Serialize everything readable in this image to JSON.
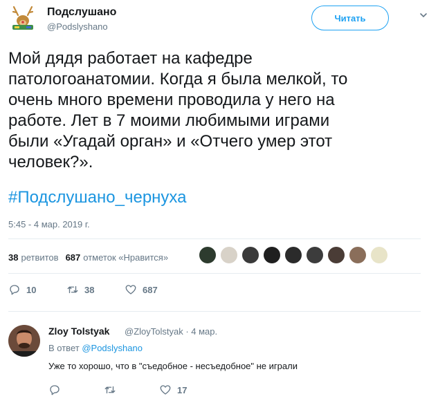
{
  "header": {
    "display_name": "Подслушано",
    "handle": "@Podslyshano",
    "follow_label": "Читать"
  },
  "tweet": {
    "text": "Мой дядя работает на кафедре\nпатологоанатомии. Когда я была мелкой, то\nочень много времени проводила у него на\nработе. Лет в 7 моими любимыми играми\nбыли «Угадай орган» и «Отчего умер этот\nчеловек?».",
    "hashtag": "#Подслушано_чернуха",
    "timestamp": "5:45 - 4 мар. 2019 г."
  },
  "stats": {
    "retweets_count": "38",
    "retweets_label": "ретвитов",
    "likes_count": "687",
    "likes_label": "отметок «Нравится»"
  },
  "likers": [
    {
      "icon": "avatar-1",
      "color": "#2d3b2e"
    },
    {
      "icon": "avatar-2",
      "color": "#d8d2c8"
    },
    {
      "icon": "avatar-3",
      "color": "#3a3a3a"
    },
    {
      "icon": "avatar-4",
      "color": "#1f1f1f"
    },
    {
      "icon": "avatar-5",
      "color": "#2b2b2b"
    },
    {
      "icon": "avatar-6",
      "color": "#3c3c3c"
    },
    {
      "icon": "avatar-7",
      "color": "#4a3c36"
    },
    {
      "icon": "avatar-8",
      "color": "#8a6e5a"
    },
    {
      "icon": "avatar-9",
      "color": "#e8e4c8"
    }
  ],
  "actions": {
    "reply_count": "10",
    "retweet_count": "38",
    "like_count": "687"
  },
  "reply": {
    "name": "Zloy Tolstyak",
    "handle_time": "@ZloyTolstyak · 4 мар.",
    "reply_to_label": "В ответ",
    "reply_to_handle": "@Podslyshano",
    "text": "Уже то хорошо, что в \"съедобное - несъедобное\" не играли",
    "like_count": "17"
  },
  "colors": {
    "accent": "#1da1f2",
    "link": "#1b95e0",
    "muted": "#657786",
    "divider": "#e6ecf0"
  }
}
